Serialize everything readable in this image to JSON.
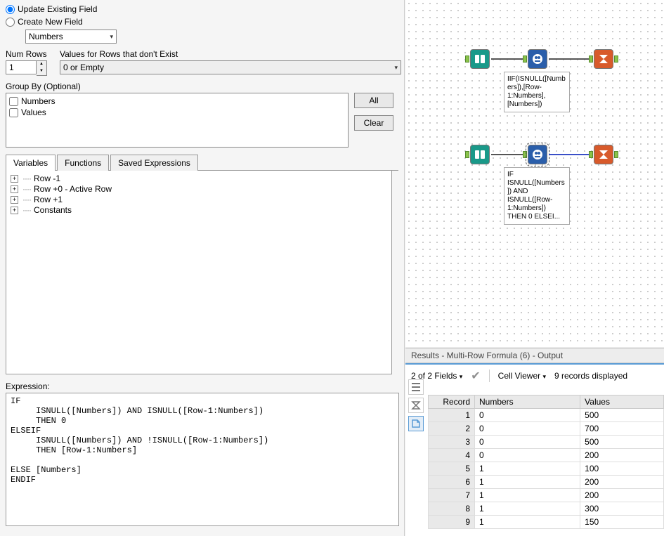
{
  "config": {
    "radio_update": "Update Existing Field",
    "radio_create": "Create New  Field",
    "field_selected": "Numbers",
    "numrows_label": "Num Rows",
    "numrows_value": "1",
    "values_nonexist_label": "Values for Rows that don't Exist",
    "values_nonexist_selected": "0 or Empty",
    "groupby_label": "Group By (Optional)",
    "groupby_items": [
      "Numbers",
      "Values"
    ],
    "btn_all": "All",
    "btn_clear": "Clear"
  },
  "tabs": {
    "variables": "Variables",
    "functions": "Functions",
    "saved": "Saved Expressions"
  },
  "tree": {
    "items": [
      "Row -1",
      "Row +0 - Active Row",
      "Row +1",
      "Constants"
    ]
  },
  "expression": {
    "label": "Expression:",
    "text": "IF\n     ISNULL([Numbers]) AND ISNULL([Row-1:Numbers])\n     THEN 0\nELSEIF\n     ISNULL([Numbers]) AND !ISNULL([Row-1:Numbers])\n     THEN [Row-1:Numbers]\n\nELSE [Numbers]\nENDIF"
  },
  "canvas": {
    "anno1": "IIF(ISNULL([Numbers]),[Row-1:Numbers],[Numbers])",
    "anno2": "IF ISNULL([Numbers]) AND ISNULL([Row-1:Numbers]) THEN 0 ELSEI..."
  },
  "results": {
    "title": "Results - Multi-Row Formula (6) - Output",
    "fields_summary": "2 of 2 Fields",
    "cell_viewer": "Cell Viewer",
    "records_summary": "9 records displayed",
    "columns": [
      "Record",
      "Numbers",
      "Values"
    ],
    "rows": [
      {
        "record": "1",
        "numbers": "0",
        "values": "500"
      },
      {
        "record": "2",
        "numbers": "0",
        "values": "700"
      },
      {
        "record": "3",
        "numbers": "0",
        "values": "500"
      },
      {
        "record": "4",
        "numbers": "0",
        "values": "200"
      },
      {
        "record": "5",
        "numbers": "1",
        "values": "100"
      },
      {
        "record": "6",
        "numbers": "1",
        "values": "200"
      },
      {
        "record": "7",
        "numbers": "1",
        "values": "200"
      },
      {
        "record": "8",
        "numbers": "1",
        "values": "300"
      },
      {
        "record": "9",
        "numbers": "1",
        "values": "150"
      }
    ]
  }
}
